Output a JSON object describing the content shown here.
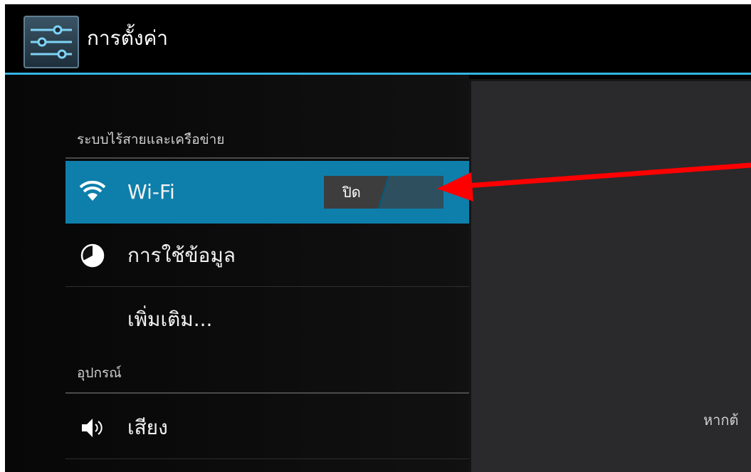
{
  "action_bar": {
    "title": "การตั้งค่า",
    "icon": "settings-sliders-icon"
  },
  "sections": {
    "wireless": {
      "header": "ระบบไร้สายและเครือข่าย",
      "items": [
        {
          "label": "Wi-Fi",
          "icon": "wifi-icon",
          "selected": true,
          "toggle": "ปิด"
        },
        {
          "label": "การใช้ข้อมูล",
          "icon": "data-usage-icon"
        },
        {
          "label": "เพิ่มเติม..."
        }
      ]
    },
    "device": {
      "header": "อุปกรณ์",
      "items": [
        {
          "label": "เสียง",
          "icon": "speaker-icon"
        }
      ]
    }
  },
  "detail_panel": {
    "text": "หากต้"
  },
  "colors": {
    "accent": "#33b5e5",
    "selected": "#0e7fab",
    "annotation": "#ff0000"
  }
}
